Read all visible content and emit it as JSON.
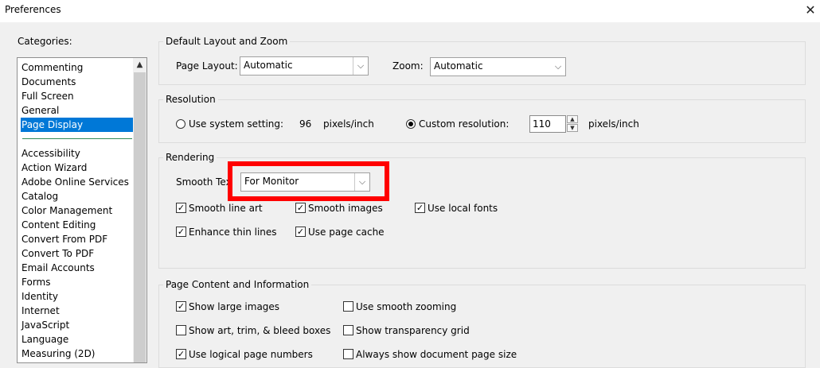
{
  "window": {
    "title": "Preferences",
    "close_glyph": "✕"
  },
  "categories": {
    "label": "Categories:",
    "items": [
      "Commenting",
      "Documents",
      "Full Screen",
      "General",
      "Page Display"
    ],
    "selected": "Page Display",
    "items2": [
      "Accessibility",
      "Action Wizard",
      "Adobe Online Services",
      "Catalog",
      "Color Management",
      "Content Editing",
      "Convert From PDF",
      "Convert To PDF",
      "Email Accounts",
      "Forms",
      "Identity",
      "Internet",
      "JavaScript",
      "Language",
      "Measuring (2D)"
    ]
  },
  "layout_zoom": {
    "legend": "Default Layout and Zoom",
    "page_layout_label": "Page Layout:",
    "page_layout_value": "Automatic",
    "zoom_label": "Zoom:",
    "zoom_value": "Automatic"
  },
  "resolution": {
    "legend": "Resolution",
    "system_label": "Use system setting:",
    "system_value": "96",
    "system_unit": "pixels/inch",
    "custom_label": "Custom resolution:",
    "custom_value": "110",
    "custom_unit": "pixels/inch",
    "selected": "custom"
  },
  "rendering": {
    "legend": "Rendering",
    "smooth_text_label": "Smooth Tex",
    "smooth_text_value": "For Monitor",
    "options": {
      "smooth_line_art": {
        "label": "Smooth line art",
        "checked": true
      },
      "smooth_images": {
        "label": "Smooth images",
        "checked": true
      },
      "use_local_fonts": {
        "label": "Use local fonts",
        "checked": true
      },
      "enhance_thin_lines": {
        "label": "Enhance thin lines",
        "checked": true
      },
      "use_page_cache": {
        "label": "Use page cache",
        "checked": true
      }
    }
  },
  "page_content": {
    "legend": "Page Content and Information",
    "options": {
      "show_large_images": {
        "label": "Show large images",
        "checked": true
      },
      "use_smooth_zooming": {
        "label": "Use smooth zooming",
        "checked": false
      },
      "show_art_trim_bleed": {
        "label": "Show art, trim, & bleed boxes",
        "checked": false
      },
      "show_transparency_grid": {
        "label": "Show transparency grid",
        "checked": false
      },
      "use_logical_page_numbers": {
        "label": "Use logical page numbers",
        "checked": true
      },
      "always_show_doc_page_size": {
        "label": "Always show document page size",
        "checked": false
      }
    }
  },
  "highlight_color": "#ff0000",
  "selection_color": "#0078d7"
}
